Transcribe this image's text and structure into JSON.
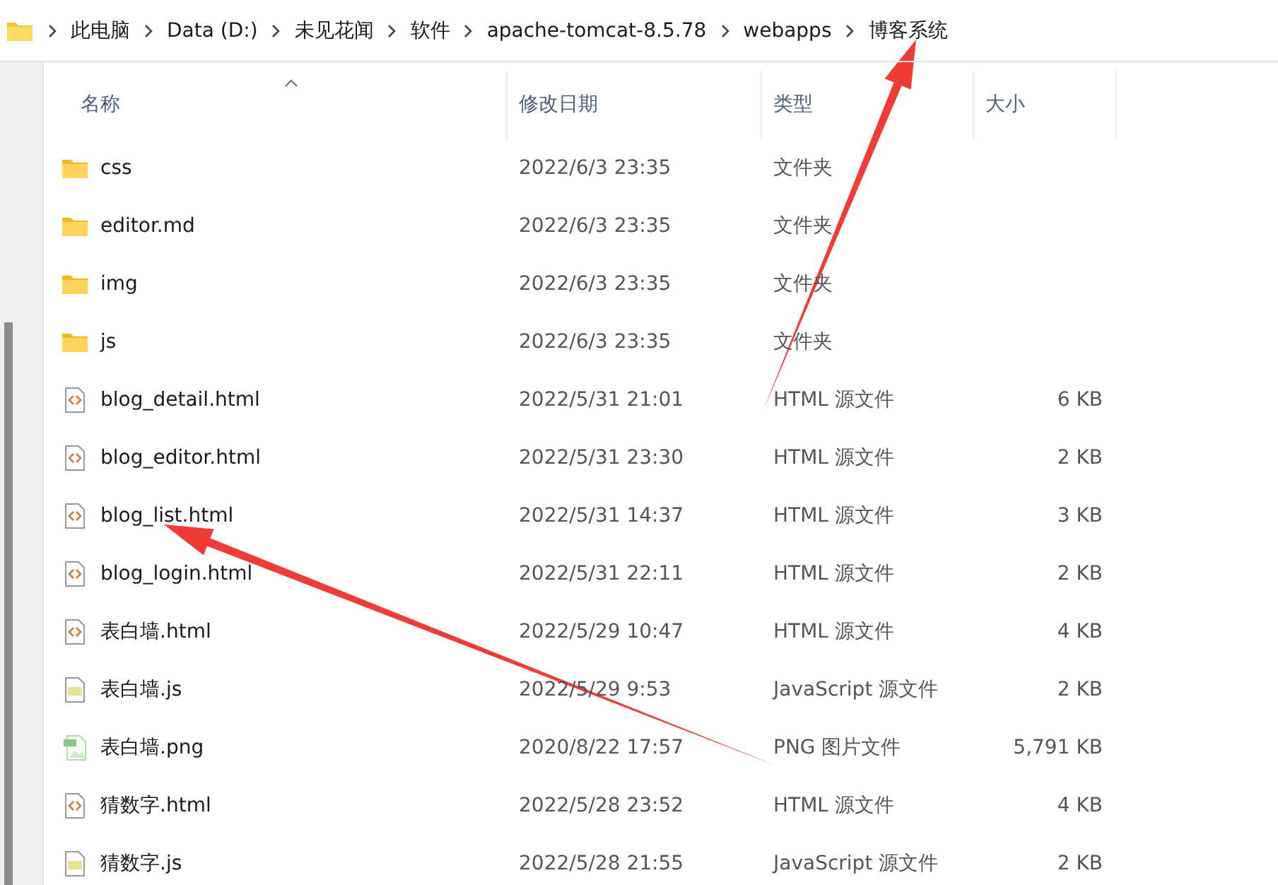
{
  "breadcrumb": [
    "此电脑",
    "Data (D:)",
    "未见花闻",
    "软件",
    "apache-tomcat-8.5.78",
    "webapps",
    "博客系统"
  ],
  "columns": [
    "名称",
    "修改日期",
    "类型",
    "大小"
  ],
  "files": [
    {
      "kind": "folder",
      "name": "css",
      "date": "2022/6/3 23:35",
      "type": "文件夹"
    },
    {
      "kind": "folder",
      "name": "editor.md",
      "date": "2022/6/3 23:35",
      "type": "文件夹"
    },
    {
      "kind": "folder",
      "name": "img",
      "date": "2022/6/3 23:35",
      "type": "文件夹"
    },
    {
      "kind": "folder",
      "name": "js",
      "date": "2022/6/3 23:35",
      "type": "文件夹"
    },
    {
      "kind": "html",
      "name": "blog_detail.html",
      "date": "2022/5/31 21:01",
      "type": "HTML 源文件",
      "size": "6 KB"
    },
    {
      "kind": "html",
      "name": "blog_editor.html",
      "date": "2022/5/31 23:30",
      "type": "HTML 源文件",
      "size": "2 KB"
    },
    {
      "kind": "html",
      "name": "blog_list.html",
      "date": "2022/5/31 14:37",
      "type": "HTML 源文件",
      "size": "3 KB"
    },
    {
      "kind": "html",
      "name": "blog_login.html",
      "date": "2022/5/31 22:11",
      "type": "HTML 源文件",
      "size": "2 KB"
    },
    {
      "kind": "html",
      "name": "表白墙.html",
      "date": "2022/5/29 10:47",
      "type": "HTML 源文件",
      "size": "4 KB"
    },
    {
      "kind": "js",
      "name": "表白墙.js",
      "date": "2022/5/29 9:53",
      "type": "JavaScript 源文件",
      "size": "2 KB"
    },
    {
      "kind": "png",
      "name": "表白墙.png",
      "date": "2020/8/22 17:57",
      "type": "PNG 图片文件",
      "size": "5,791 KB"
    },
    {
      "kind": "html",
      "name": "猜数字.html",
      "date": "2022/5/28 23:52",
      "type": "HTML 源文件",
      "size": "4 KB"
    },
    {
      "kind": "js",
      "name": "猜数字.js",
      "date": "2022/5/28 21:55",
      "type": "JavaScript 源文件",
      "size": "2 KB"
    }
  ]
}
